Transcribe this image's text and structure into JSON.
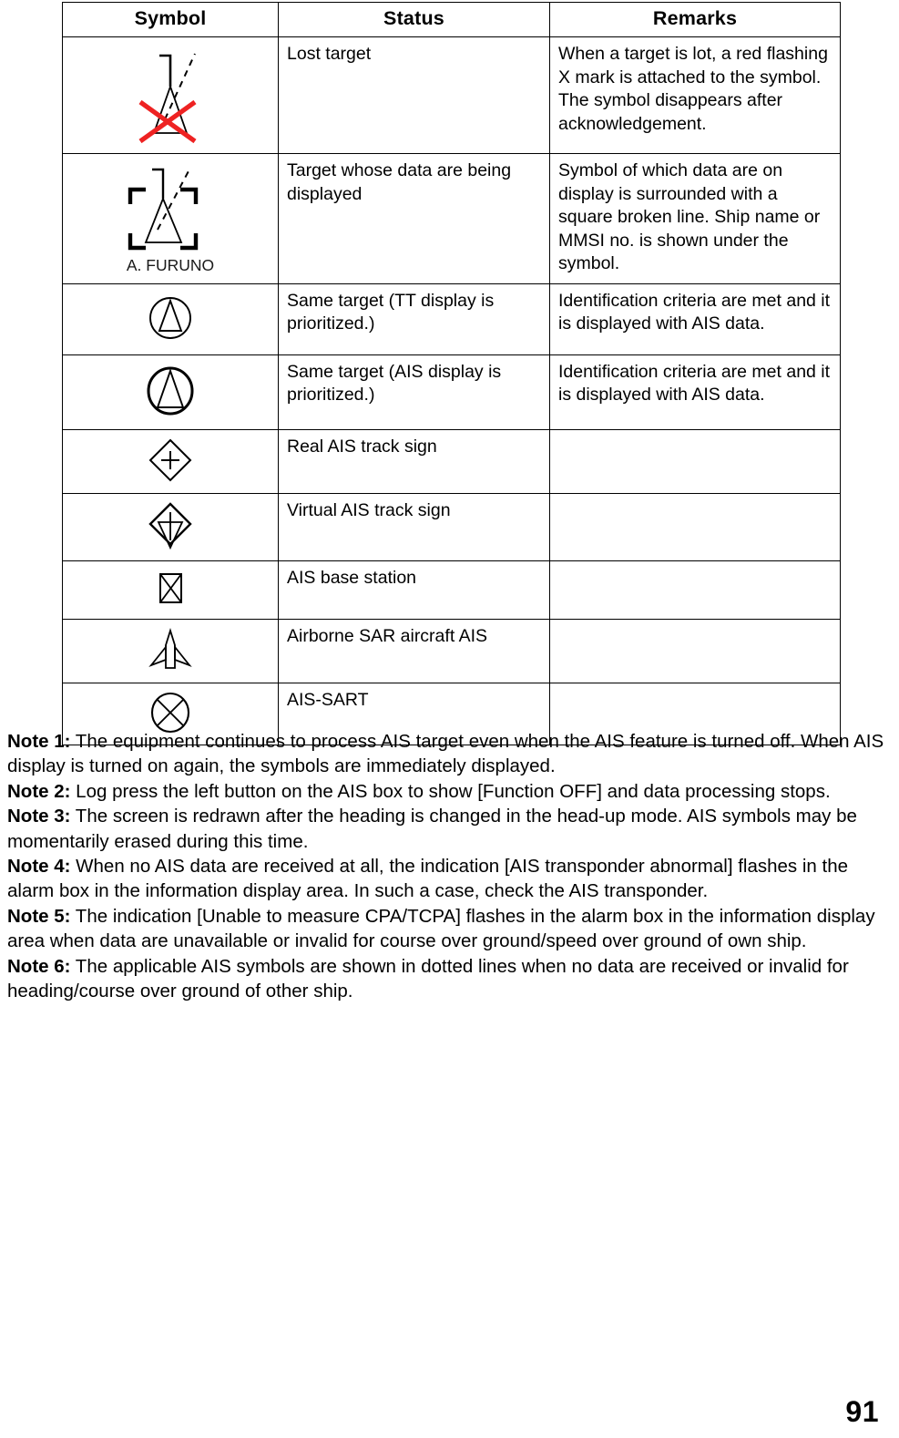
{
  "table": {
    "headers": [
      "Symbol",
      "Status",
      "Remarks"
    ],
    "rows": [
      {
        "symbol_icon": "lost-target-symbol",
        "symbol_caption": "",
        "status": "Lost target",
        "remarks": "When a target is lot, a red flashing X mark is attached to the symbol. The symbol disappears after acknowledgement."
      },
      {
        "symbol_icon": "selected-target-symbol",
        "symbol_caption": "A. FURUNO",
        "status": "Target whose data are being displayed",
        "remarks": "Symbol of which data are on display is surrounded with a square broken line. Ship name or MMSI no. is shown under the symbol."
      },
      {
        "symbol_icon": "same-target-tt-priority-symbol",
        "symbol_caption": "",
        "status": "Same target (TT display is prioritized.)",
        "remarks": "Identification criteria are met and it is displayed with AIS data."
      },
      {
        "symbol_icon": "same-target-ais-priority-symbol",
        "symbol_caption": "",
        "status": "Same target (AIS display is prioritized.)",
        "remarks": "Identification criteria are met and it is displayed with AIS data."
      },
      {
        "symbol_icon": "real-ais-track-sign-symbol",
        "symbol_caption": "",
        "status": "Real AIS track sign",
        "remarks": ""
      },
      {
        "symbol_icon": "virtual-ais-track-sign-symbol",
        "symbol_caption": "",
        "status": "Virtual AIS track sign",
        "remarks": ""
      },
      {
        "symbol_icon": "ais-base-station-symbol",
        "symbol_caption": "",
        "status": "AIS base station",
        "remarks": ""
      },
      {
        "symbol_icon": "airborne-sar-aircraft-symbol",
        "symbol_caption": "",
        "status": "Airborne SAR aircraft AIS",
        "remarks": ""
      },
      {
        "symbol_icon": "ais-sart-symbol",
        "symbol_caption": "",
        "status": "AIS-SART",
        "remarks": ""
      }
    ]
  },
  "notes": [
    {
      "label": "Note 1:",
      "text": " The equipment continues to process AIS target even when the AIS feature is turned off. When AIS display is turned on again, the symbols are immediately displayed."
    },
    {
      "label": "Note 2:",
      "text": " Log press the left button on the AIS box to show [Function OFF] and data processing stops."
    },
    {
      "label": "Note 3:",
      "text": " The screen is redrawn after the heading is changed in the head-up mode. AIS symbols may be momentarily erased during this time."
    },
    {
      "label": "Note 4:",
      "text": " When no AIS data are received at all, the indication [AIS transponder abnormal] flashes in the alarm box in the information display area. In such a case, check the AIS transponder."
    },
    {
      "label": "Note 5:",
      "text": " The indication [Unable to measure CPA/TCPA] flashes in the alarm box in the information display area when data are unavailable or invalid for course over ground/speed over ground of own ship."
    },
    {
      "label": "Note 6:",
      "text": " The applicable AIS symbols are shown in dotted lines when no data are received or invalid for heading/course over ground of other ship."
    }
  ],
  "page_number": "91",
  "colors": {
    "lost_target_cross": "#ee2222",
    "text": "#000000",
    "border": "#000000"
  }
}
